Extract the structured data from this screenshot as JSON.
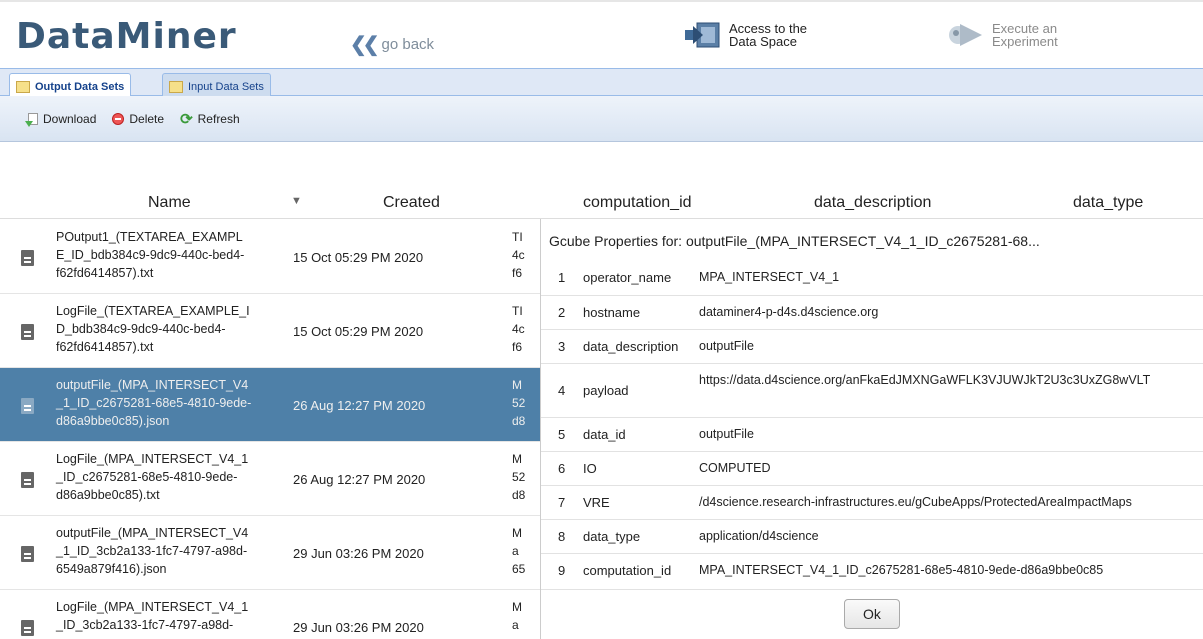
{
  "header": {
    "logo": "DataMiner",
    "go_back": "go back",
    "access_label_1": "Access to the",
    "access_label_2": "Data Space",
    "execute_label_1": "Execute an",
    "execute_label_2": "Experiment"
  },
  "tabs": [
    {
      "label": "Output Data Sets",
      "active": true
    },
    {
      "label": "Input Data Sets",
      "active": false
    }
  ],
  "toolbar": {
    "download": "Download",
    "delete": "Delete",
    "refresh": "Refresh"
  },
  "grid": {
    "columns": {
      "name": "Name",
      "created": "Created",
      "computation_id": "computation_id",
      "data_description": "data_description",
      "data_type": "data_type"
    },
    "sort_icon": "sort-desc-icon",
    "rows": [
      {
        "name": [
          "POutput1_(TEXTAREA_EXAMPL",
          "E_ID_bdb384c9-9dc9-440c-bed4-",
          "f62fd6414857).txt"
        ],
        "created": "15 Oct 05:29 PM 2020",
        "cid": [
          "TI",
          "4c",
          "f6"
        ]
      },
      {
        "name": [
          "LogFile_(TEXTAREA_EXAMPLE_I",
          "D_bdb384c9-9dc9-440c-bed4-",
          "f62fd6414857).txt"
        ],
        "created": "15 Oct 05:29 PM 2020",
        "cid": [
          "TI",
          "4c",
          "f6"
        ]
      },
      {
        "name": [
          "outputFile_(MPA_INTERSECT_V4",
          "_1_ID_c2675281-68e5-4810-9ede-",
          "d86a9bbe0c85).json"
        ],
        "created": "26 Aug 12:27 PM 2020",
        "cid": [
          "M",
          "52",
          "d8"
        ],
        "selected": true
      },
      {
        "name": [
          "LogFile_(MPA_INTERSECT_V4_1",
          "_ID_c2675281-68e5-4810-9ede-",
          "d86a9bbe0c85).txt"
        ],
        "created": "26 Aug 12:27 PM 2020",
        "cid": [
          "M",
          "52",
          "d8"
        ]
      },
      {
        "name": [
          "outputFile_(MPA_INTERSECT_V4",
          "_1_ID_3cb2a133-1fc7-4797-a98d-",
          "6549a879f416).json"
        ],
        "created": "29 Jun 03:26 PM 2020",
        "cid": [
          "M",
          "a",
          "65"
        ]
      },
      {
        "name": [
          "LogFile_(MPA_INTERSECT_V4_1",
          "_ID_3cb2a133-1fc7-4797-a98d-",
          ""
        ],
        "created": "29 Jun 03:26 PM 2020",
        "cid": [
          "M",
          "a",
          ""
        ]
      }
    ]
  },
  "popup": {
    "title": "Gcube Properties for: outputFile_(MPA_INTERSECT_V4_1_ID_c2675281-68...",
    "properties": [
      {
        "n": "1",
        "key": "operator_name",
        "value": "MPA_INTERSECT_V4_1"
      },
      {
        "n": "2",
        "key": "hostname",
        "value": "dataminer4-p-d4s.d4science.org"
      },
      {
        "n": "3",
        "key": "data_description",
        "value": "outputFile"
      },
      {
        "n": "4",
        "key": "payload",
        "value": "https://data.d4science.org/anFkaEdJMXNGaWFLK3VJUWJkT2U3c3UxZG8wVLT"
      },
      {
        "n": "5",
        "key": "data_id",
        "value": "outputFile"
      },
      {
        "n": "6",
        "key": "IO",
        "value": "COMPUTED"
      },
      {
        "n": "7",
        "key": "VRE",
        "value": "/d4science.research-infrastructures.eu/gCubeApps/ProtectedAreaImpactMaps"
      },
      {
        "n": "8",
        "key": "data_type",
        "value": "application/d4science"
      },
      {
        "n": "9",
        "key": "computation_id",
        "value": "MPA_INTERSECT_V4_1_ID_c2675281-68e5-4810-9ede-d86a9bbe0c85"
      }
    ],
    "ok": "Ok"
  }
}
